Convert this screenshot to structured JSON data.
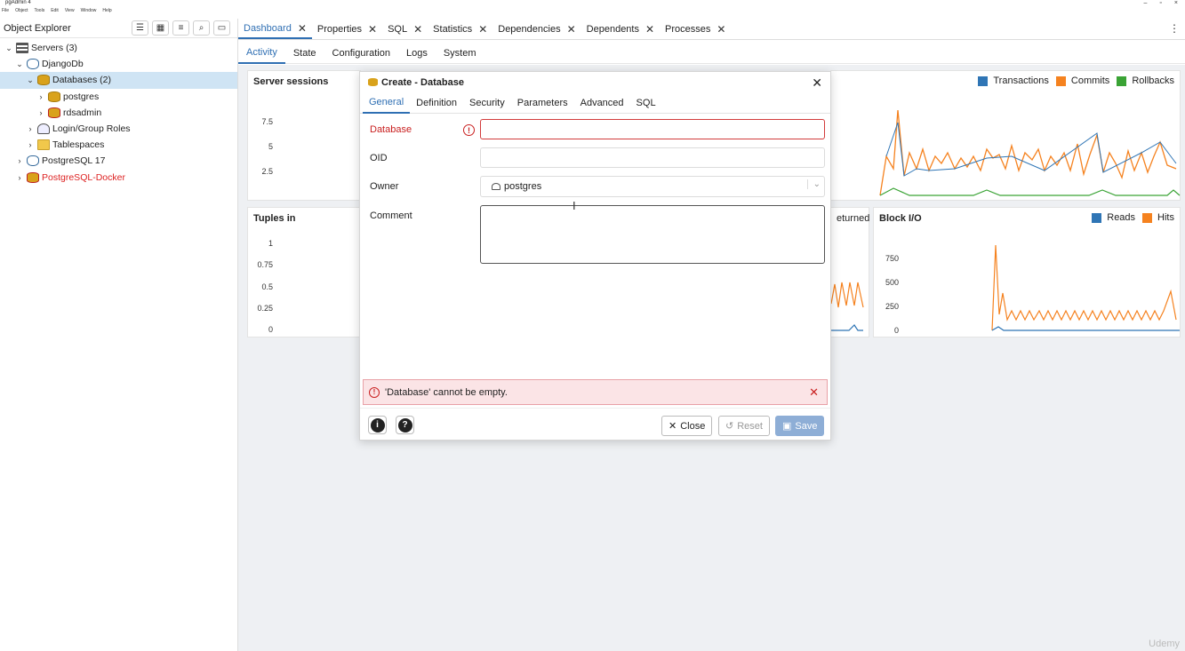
{
  "window": {
    "title": "pgAdmin 4",
    "menu": [
      "File",
      "Object",
      "Tools",
      "Edit",
      "View",
      "Window",
      "Help"
    ]
  },
  "object_explorer": {
    "title": "Object Explorer",
    "tree": [
      {
        "label": "Servers (3)",
        "indent": 0,
        "icon": "server-icon",
        "expanded": true
      },
      {
        "label": "DjangoDb",
        "indent": 1,
        "icon": "postgres-elephant-icon",
        "expanded": true
      },
      {
        "label": "Databases (2)",
        "indent": 2,
        "icon": "databases-icon",
        "expanded": true,
        "selected": true
      },
      {
        "label": "postgres",
        "indent": 3,
        "icon": "database-icon",
        "expanded": false
      },
      {
        "label": "rdsadmin",
        "indent": 3,
        "icon": "database-disconnected-icon",
        "expanded": false
      },
      {
        "label": "Login/Group Roles",
        "indent": 2,
        "icon": "roles-icon",
        "expanded": false
      },
      {
        "label": "Tablespaces",
        "indent": 2,
        "icon": "tablespaces-icon",
        "expanded": false
      },
      {
        "label": "PostgreSQL 17",
        "indent": 1,
        "icon": "postgres-elephant-icon",
        "expanded": false
      },
      {
        "label": "PostgreSQL-Docker",
        "indent": 1,
        "icon": "postgres-disconnected-icon",
        "expanded": false,
        "error": true
      }
    ]
  },
  "tabs": [
    "Dashboard",
    "Properties",
    "SQL",
    "Statistics",
    "Dependencies",
    "Dependents",
    "Processes"
  ],
  "subtabs": [
    "Activity",
    "State",
    "Configuration",
    "Logs",
    "System"
  ],
  "panels": {
    "server_sessions": {
      "title": "Server sessions",
      "ticks": [
        "7.5",
        "5",
        "2.5"
      ]
    },
    "transactions": {
      "legend": [
        "Transactions",
        "Commits",
        "Rollbacks"
      ]
    },
    "tuples_in": {
      "title": "Tuples in",
      "ticks": [
        "1",
        "0.75",
        "0.5",
        "0.25",
        "0"
      ]
    },
    "returned": {
      "title": "eturned"
    },
    "block_io": {
      "title": "Block I/O",
      "legend": [
        "Reads",
        "Hits"
      ],
      "ticks": [
        "750",
        "500",
        "250",
        "0"
      ]
    }
  },
  "dialog": {
    "title": "Create - Database",
    "tabs": [
      "General",
      "Definition",
      "Security",
      "Parameters",
      "Advanced",
      "SQL"
    ],
    "labels": {
      "database": "Database",
      "oid": "OID",
      "owner": "Owner",
      "comment": "Comment"
    },
    "owner_value": "postgres",
    "error": "'Database' cannot be empty.",
    "buttons": {
      "close": "Close",
      "reset": "Reset",
      "save": "Save"
    }
  },
  "colors": {
    "blue": "#2f75b5",
    "orange": "#f5821f",
    "green": "#3aa335",
    "accent": "#2f6fb3"
  },
  "watermark": "Udemy"
}
